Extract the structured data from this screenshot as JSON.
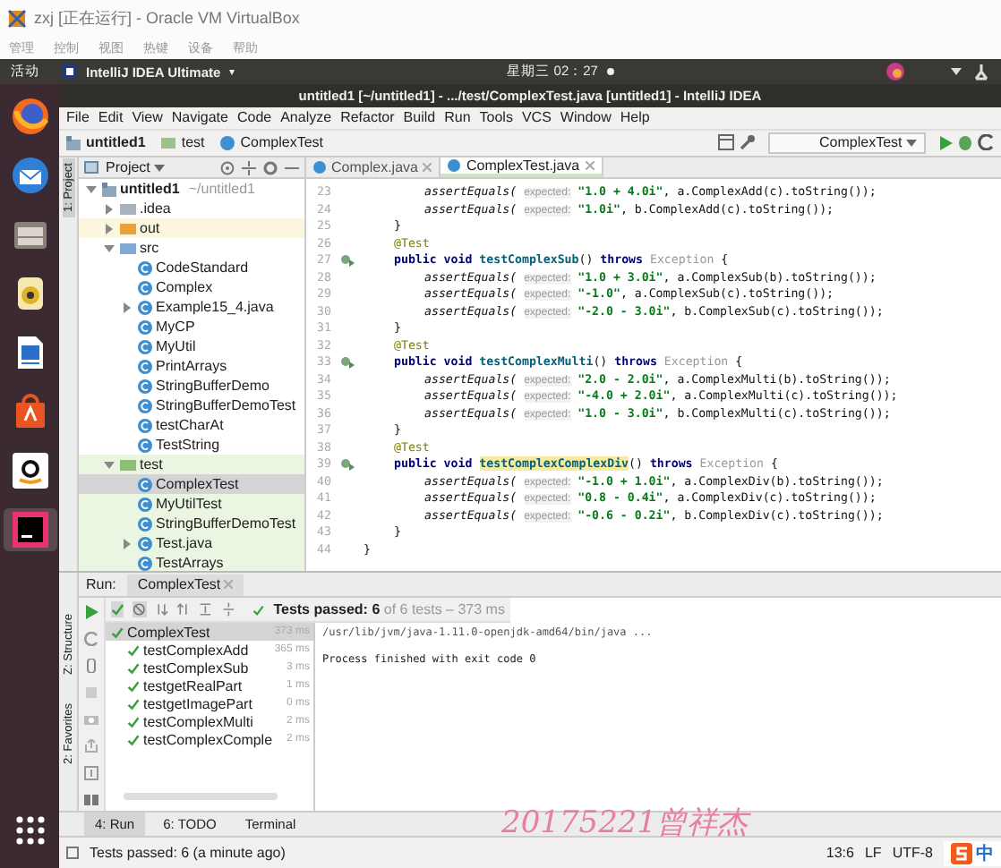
{
  "vm_window": {
    "title": "zxj [正在运行] - Oracle VM VirtualBox",
    "menu": [
      "管理",
      "控制",
      "视图",
      "热键",
      "设备",
      "帮助"
    ]
  },
  "top_bar": {
    "activities": "活动",
    "app": "IntelliJ IDEA Ultimate",
    "app_caret": "▾",
    "clock": "星期三 02：27"
  },
  "ide": {
    "title": "untitled1 [~/untitled1] - .../test/ComplexTest.java [untitled1] - IntelliJ IDEA",
    "menu": [
      "File",
      "Edit",
      "View",
      "Navigate",
      "Code",
      "Analyze",
      "Refactor",
      "Build",
      "Run",
      "Tools",
      "VCS",
      "Window",
      "Help"
    ],
    "breadcrumbs": [
      {
        "label": "untitled1",
        "kind": "module"
      },
      {
        "label": "test",
        "kind": "folder"
      },
      {
        "label": "ComplexTest",
        "kind": "class"
      }
    ],
    "run_config": "ComplexTest",
    "side_tabs": [
      {
        "label": "1: Project",
        "selected": true
      }
    ],
    "lower_side_tabs": [
      {
        "label": "Z: Structure",
        "selected": false
      },
      {
        "label": "2: Favorites",
        "selected": false
      }
    ],
    "project": {
      "title": "Project",
      "tree": [
        {
          "label": "untitled1",
          "hint": "~/untitled1",
          "kind": "module",
          "expanded": true,
          "selected": false,
          "children": [
            {
              "label": ".idea",
              "kind": "folder",
              "expanded": false,
              "selected": false
            },
            {
              "label": "out",
              "kind": "folder-excluded",
              "expanded": false,
              "selected": false
            },
            {
              "label": "src",
              "kind": "folder-source",
              "expanded": true,
              "selected": false,
              "children": [
                {
                  "label": "CodeStandard",
                  "kind": "class",
                  "selected": false
                },
                {
                  "label": "Complex",
                  "kind": "class",
                  "selected": false
                },
                {
                  "label": "Example15_4.java",
                  "kind": "class",
                  "expanded": false,
                  "selected": false
                },
                {
                  "label": "MyCP",
                  "kind": "class",
                  "selected": false
                },
                {
                  "label": "MyUtil",
                  "kind": "class",
                  "selected": false
                },
                {
                  "label": "PrintArrays",
                  "kind": "class",
                  "selected": false
                },
                {
                  "label": "StringBufferDemo",
                  "kind": "class",
                  "selected": false
                },
                {
                  "label": "StringBufferDemoTest",
                  "kind": "class",
                  "selected": false
                },
                {
                  "label": "testCharAt",
                  "kind": "class",
                  "selected": false
                },
                {
                  "label": "TestString",
                  "kind": "class",
                  "selected": false
                }
              ]
            },
            {
              "label": "test",
              "kind": "folder-test",
              "expanded": true,
              "selected": false,
              "children": [
                {
                  "label": "ComplexTest",
                  "kind": "class",
                  "selected": true
                },
                {
                  "label": "MyUtilTest",
                  "kind": "class",
                  "selected": false
                },
                {
                  "label": "StringBufferDemoTest",
                  "kind": "class",
                  "selected": false
                },
                {
                  "label": "Test.java",
                  "kind": "class",
                  "expanded": false,
                  "selected": false
                },
                {
                  "label": "TestArrays",
                  "kind": "class",
                  "selected": false
                }
              ]
            }
          ]
        }
      ]
    },
    "editor_tabs": [
      {
        "label": "Complex.java",
        "selected": false
      },
      {
        "label": "ComplexTest.java",
        "selected": true
      }
    ],
    "code": [
      {
        "n": "23",
        "kind": "assert",
        "call": "assertEquals(",
        "hint": "expected:",
        "value": "\"1.0 + 4.0i\"",
        "rest": ", a.ComplexAdd(c).toString());"
      },
      {
        "n": "24",
        "kind": "assert",
        "call": "assertEquals(",
        "hint": "expected:",
        "value": "\"1.0i\"",
        "rest": ", b.ComplexAdd(c).toString());"
      },
      {
        "n": "25",
        "kind": "close-method",
        "text": "}"
      },
      {
        "n": "26",
        "kind": "annotation",
        "text": "@Test"
      },
      {
        "n": "27",
        "kind": "method",
        "modifiers": "public void",
        "name": "testComplexSub",
        "args": "()",
        "throws": "throws",
        "exception": "Exception",
        "brace": "{",
        "highlighted": false
      },
      {
        "n": "28",
        "kind": "assert",
        "call": "assertEquals(",
        "hint": "expected:",
        "value": "\"1.0 + 3.0i\"",
        "rest": ", a.ComplexSub(b).toString());"
      },
      {
        "n": "29",
        "kind": "assert",
        "call": "assertEquals(",
        "hint": "expected:",
        "value": "\"-1.0\"",
        "rest": ", a.ComplexSub(c).toString());"
      },
      {
        "n": "30",
        "kind": "assert",
        "call": "assertEquals(",
        "hint": "expected:",
        "value": "\"-2.0 - 3.0i\"",
        "rest": ", b.ComplexSub(c).toString());"
      },
      {
        "n": "31",
        "kind": "close-method",
        "text": "}"
      },
      {
        "n": "32",
        "kind": "annotation",
        "text": "@Test"
      },
      {
        "n": "33",
        "kind": "method",
        "modifiers": "public void",
        "name": "testComplexMulti",
        "args": "()",
        "throws": "throws",
        "exception": "Exception",
        "brace": "{",
        "highlighted": false
      },
      {
        "n": "34",
        "kind": "assert",
        "call": "assertEquals(",
        "hint": "expected:",
        "value": "\"2.0 - 2.0i\"",
        "rest": ", a.ComplexMulti(b).toString());"
      },
      {
        "n": "35",
        "kind": "assert",
        "call": "assertEquals(",
        "hint": "expected:",
        "value": "\"-4.0 + 2.0i\"",
        "rest": ", a.ComplexMulti(c).toString());"
      },
      {
        "n": "36",
        "kind": "assert",
        "call": "assertEquals(",
        "hint": "expected:",
        "value": "\"1.0 - 3.0i\"",
        "rest": ", b.ComplexMulti(c).toString());"
      },
      {
        "n": "37",
        "kind": "close-method",
        "text": "}"
      },
      {
        "n": "38",
        "kind": "annotation",
        "text": "@Test"
      },
      {
        "n": "39",
        "kind": "method",
        "modifiers": "public void",
        "name": "testComplexComplexDiv",
        "args": "()",
        "throws": "throws",
        "exception": "Exception",
        "brace": "{",
        "highlighted": true
      },
      {
        "n": "40",
        "kind": "assert",
        "call": "assertEquals(",
        "hint": "expected:",
        "value": "\"-1.0 + 1.0i\"",
        "rest": ", a.ComplexDiv(b).toString());"
      },
      {
        "n": "41",
        "kind": "assert",
        "call": "assertEquals(",
        "hint": "expected:",
        "value": "\"0.8 - 0.4i\"",
        "rest": ", a.ComplexDiv(c).toString());"
      },
      {
        "n": "42",
        "kind": "assert",
        "call": "assertEquals(",
        "hint": "expected:",
        "value": "\"-0.6 - 0.2i\"",
        "rest": ", b.ComplexDiv(c).toString());"
      },
      {
        "n": "43",
        "kind": "close-method",
        "text": "}"
      },
      {
        "n": "44",
        "kind": "close-class",
        "text": "}"
      }
    ],
    "run": {
      "label": "Run:",
      "tab": "ComplexTest",
      "summary": "Tests passed: 6",
      "summary_rest": "of 6 tests – 373 ms",
      "tests": [
        {
          "name": "ComplexTest",
          "time": "373 ms",
          "passed": true,
          "selected": true,
          "children": [
            {
              "name": "testComplexAdd",
              "time": "365 ms",
              "passed": true,
              "selected": false
            },
            {
              "name": "testComplexSub",
              "time": "3 ms",
              "passed": true,
              "selected": false
            },
            {
              "name": "testgetRealPart",
              "time": "1 ms",
              "passed": true,
              "selected": false
            },
            {
              "name": "testgetImagePart",
              "time": "0 ms",
              "passed": true,
              "selected": false
            },
            {
              "name": "testComplexMulti",
              "time": "2 ms",
              "passed": true,
              "selected": false
            },
            {
              "name": "testComplexComple",
              "time": "2 ms",
              "passed": true,
              "selected": false
            }
          ]
        }
      ],
      "console": [
        "/usr/lib/jvm/java-1.11.0-openjdk-amd64/bin/java ...",
        "Process finished with exit code 0"
      ]
    },
    "tool_tabs": [
      {
        "label": "4: Run",
        "selected": true
      },
      {
        "label": "6: TODO",
        "selected": false
      },
      {
        "label": "Terminal",
        "selected": false
      }
    ],
    "status_bar": {
      "message": "Tests passed: 6 (a minute ago)",
      "position": "13:6",
      "line_separator": "LF",
      "encoding": "UTF-8"
    }
  },
  "annotation": "20175221曾祥杰",
  "ime": {
    "label": "中"
  }
}
